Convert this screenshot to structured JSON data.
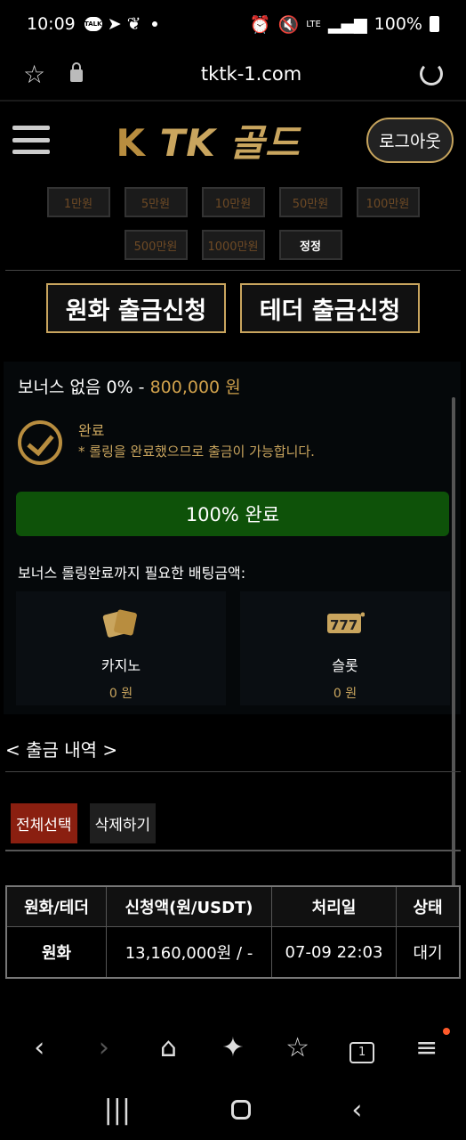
{
  "status_bar": {
    "time": "10:09",
    "notif_talk": "TALK",
    "battery": "100%",
    "network": "LTE"
  },
  "browser": {
    "url": "tktk-1.com",
    "tab_count": "1"
  },
  "site": {
    "logo_mark": "K",
    "logo_text": "TK 골드",
    "logout_label": "로그아웃"
  },
  "amount_buttons": [
    "1만원",
    "5만원",
    "10만원",
    "50만원",
    "100만원",
    "500만원",
    "1000만원"
  ],
  "reset_label": "정정",
  "withdraw_buttons": {
    "krw": "원화 출금신청",
    "tether": "테더 출금신청"
  },
  "bonus": {
    "title": "보너스 없음 0%",
    "separator": "-",
    "amount": "800,000 원",
    "status_title": "완료",
    "status_desc": "* 롤링을 완료했으므로 출금이 가능합니다.",
    "progress_label": "100%  완료",
    "progress_value": 100,
    "needed_label": "보너스 롤링완료까지 필요한 배팅금액:",
    "games": [
      {
        "name": "카지노",
        "value": "0 원",
        "icon": "cards-icon"
      },
      {
        "name": "슬롯",
        "value": "0 원",
        "icon": "slot-777-icon"
      }
    ]
  },
  "history": {
    "title": "< 출금 내역 >",
    "select_all": "전체선택",
    "delete": "삭제하기",
    "columns": [
      "원화/테더",
      "신청액(원/USDT)",
      "처리일",
      "상태"
    ],
    "rows": [
      {
        "type": "원화",
        "amount": "13,160,000원 / -",
        "date": "07-09 22:03",
        "status": "대기"
      }
    ]
  }
}
